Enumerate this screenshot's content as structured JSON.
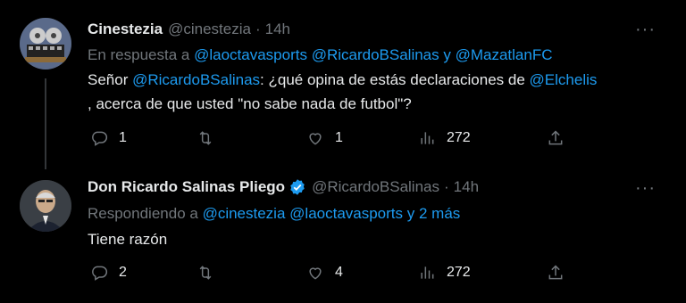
{
  "tweets": [
    {
      "name": "Cinestezia",
      "handle": "@cinestezia",
      "separator": "·",
      "time": "14h",
      "reply_prefix": "En respuesta a",
      "reply_mentions_1": "@laoctavasports",
      "reply_mentions_2": "@RicardoBSalinas",
      "reply_connector": "y",
      "reply_mentions_3": "@MazatlanFC",
      "text_1": "Señor",
      "text_mention_1": "@RicardoBSalinas",
      "text_2": ": ¿qué opina de estás declaraciones de",
      "text_mention_2": "@Elchelis",
      "text_3": ", acerca de que usted \"no sabe nada de futbol\"?",
      "replies": "1",
      "retweets": "",
      "likes": "1",
      "views": "272"
    },
    {
      "name": "Don Ricardo Salinas Pliego",
      "verified": true,
      "handle": "@RicardoBSalinas",
      "separator": "·",
      "time": "14h",
      "reply_prefix": "Respondiendo a",
      "reply_mentions_1": "@cinestezia",
      "reply_mentions_2": "@laoctavasports",
      "reply_connector": "y 2 más",
      "text_1": "Tiene razón",
      "replies": "2",
      "retweets": "",
      "likes": "4",
      "views": "272"
    }
  ],
  "more_label": "···",
  "colors": {
    "accent": "#1d9bf0",
    "muted": "#71767b",
    "text": "#e7e9ea",
    "background": "#000000"
  }
}
